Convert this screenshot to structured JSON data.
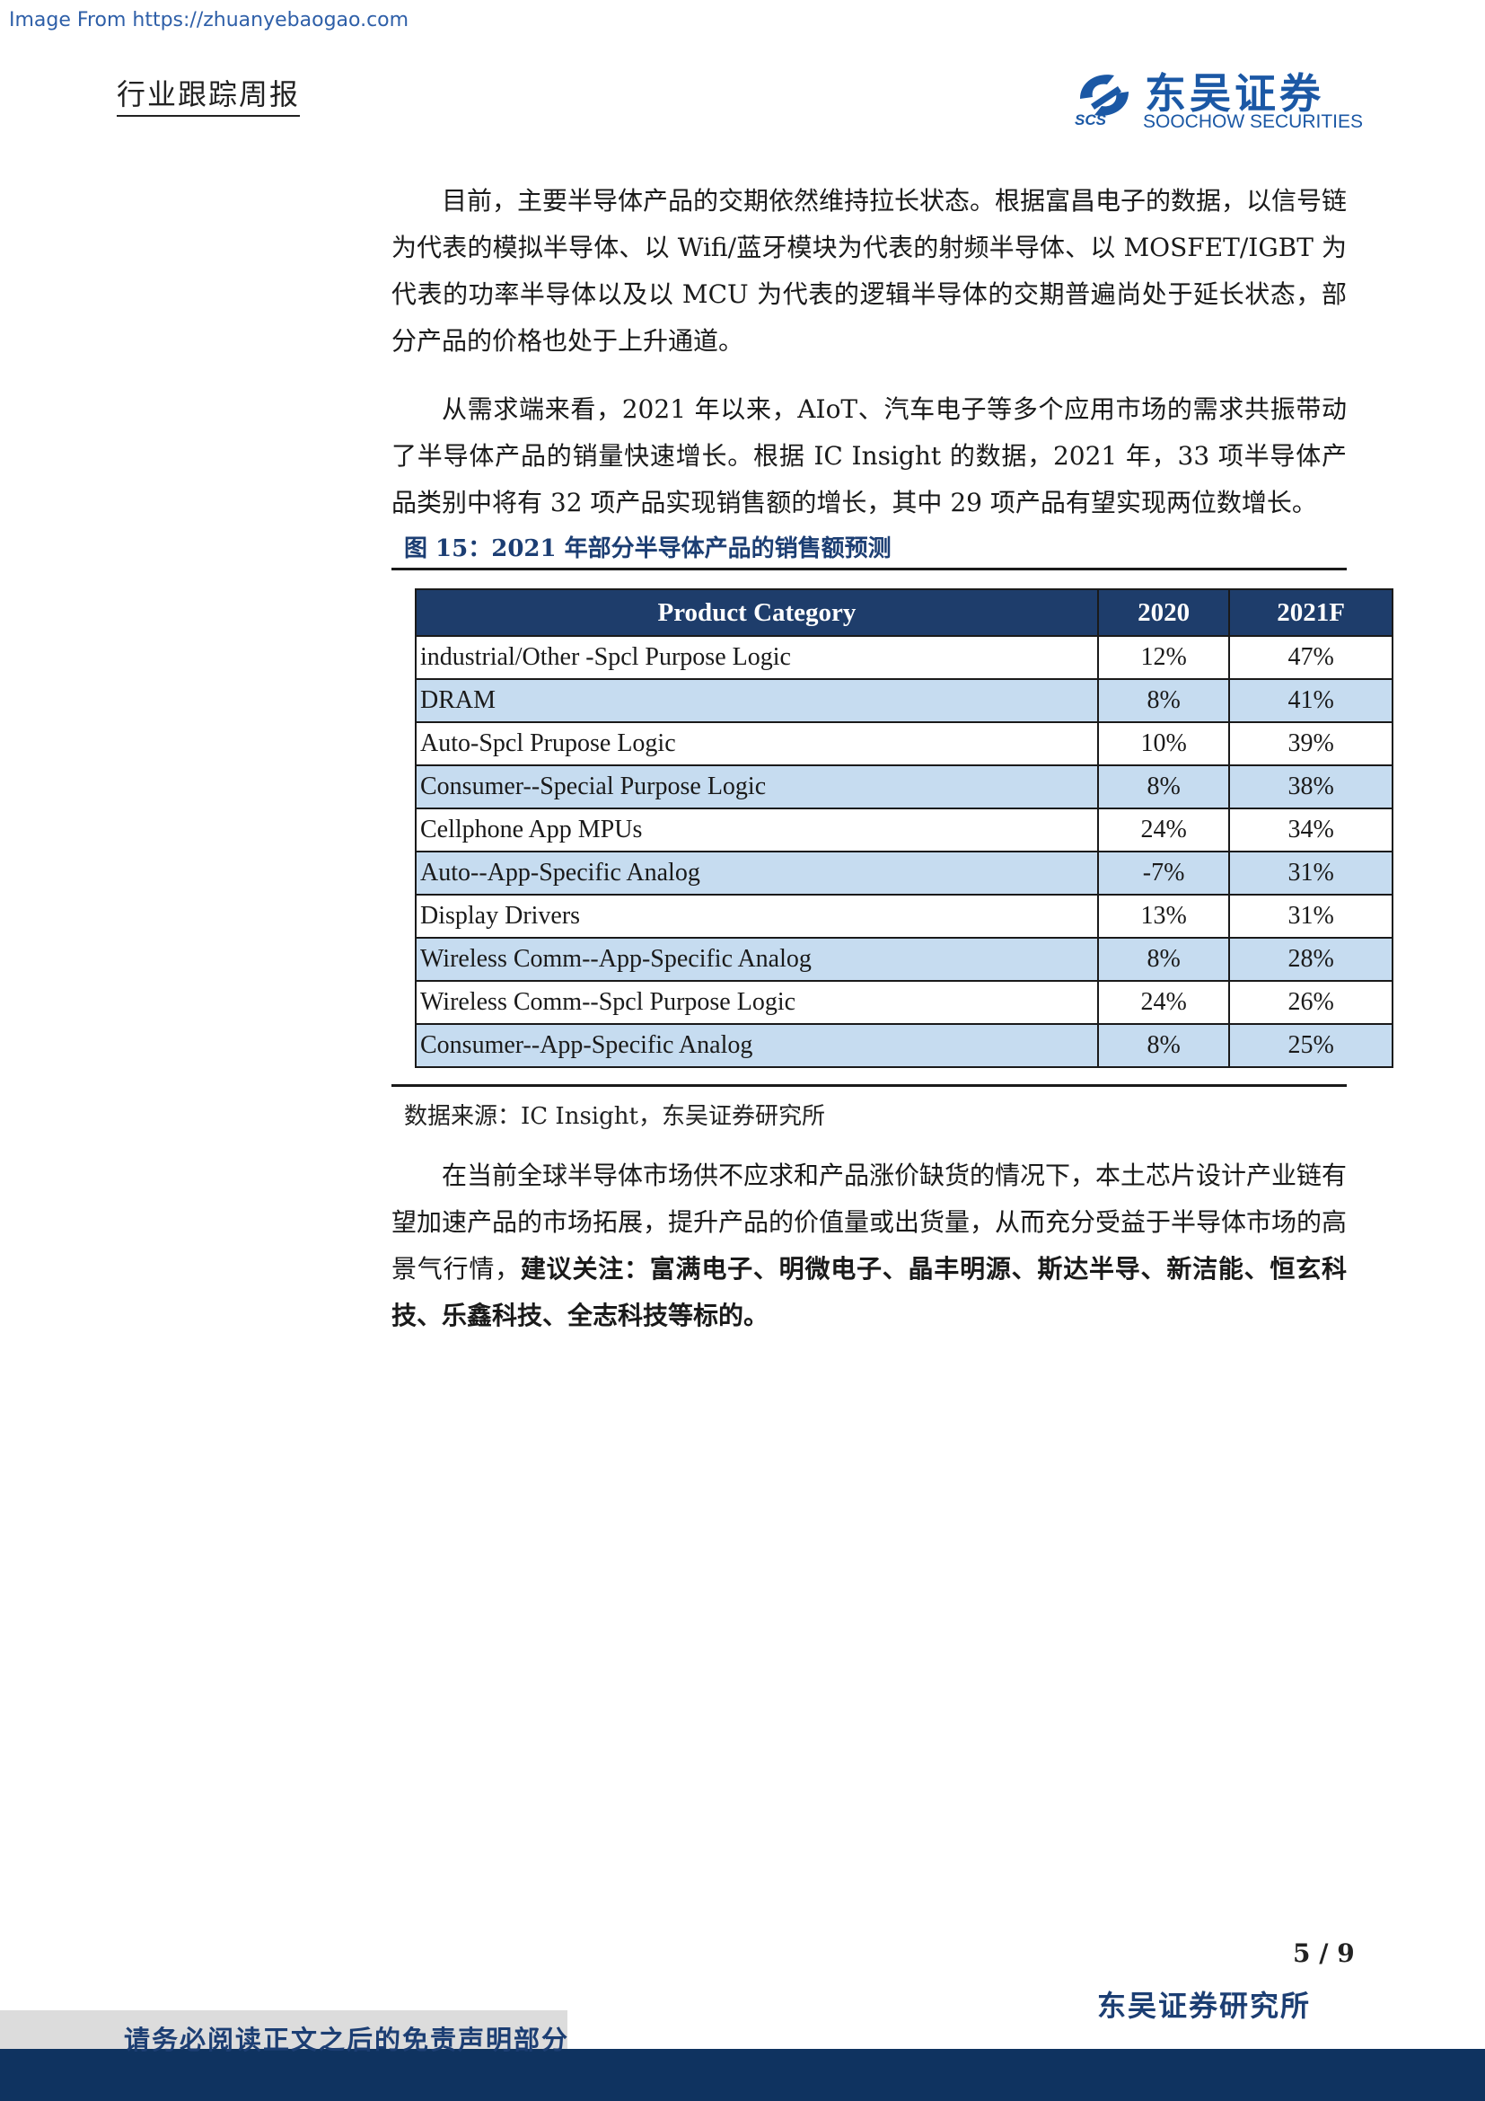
{
  "watermark": "Image From https://zhuanyebaogao.com",
  "header": {
    "report_type": "行业跟踪周报",
    "logo_cn": "东吴证券",
    "logo_en": "SOOCHOW SECURITIES",
    "logo_abbr": "SCS"
  },
  "paragraphs": [
    "目前，主要半导体产品的交期依然维持拉长状态。根据富昌电子的数据，以信号链为代表的模拟半导体、以 Wifi/蓝牙模块为代表的射频半导体、以 MOSFET/IGBT 为代表的功率半导体以及以 MCU 为代表的逻辑半导体的交期普遍尚处于延长状态，部分产品的价格也处于上升通道。",
    "从需求端来看，2021 年以来，AIoT、汽车电子等多个应用市场的需求共振带动了半导体产品的销量快速增长。根据 IC Insight 的数据，2021 年，33 项半导体产品类别中将有 32 项产品实现销售额的增长，其中 29 项产品有望实现两位数增长。"
  ],
  "figure": {
    "title": "图 15：2021 年部分半导体产品的销售额预测",
    "headers": [
      "Product Category",
      "2020",
      "2021F"
    ],
    "rows": [
      [
        "industrial/Other -Spcl Purpose Logic",
        "12%",
        "47%"
      ],
      [
        "DRAM",
        "8%",
        "41%"
      ],
      [
        "Auto-Spcl Prupose Logic",
        "10%",
        "39%"
      ],
      [
        "Consumer--Special Purpose Logic",
        "8%",
        "38%"
      ],
      [
        "Cellphone App MPUs",
        "24%",
        "34%"
      ],
      [
        "Auto--App-Specific Analog",
        "-7%",
        "31%"
      ],
      [
        "Display Drivers",
        "13%",
        "31%"
      ],
      [
        "Wireless Comm--App-Specific Analog",
        "8%",
        "28%"
      ],
      [
        "Wireless Comm--Spcl Purpose Logic",
        "24%",
        "26%"
      ],
      [
        "Consumer--App-Specific Analog",
        "8%",
        "25%"
      ]
    ],
    "source": "数据来源：IC Insight，东吴证券研究所"
  },
  "closing": {
    "text": "在当前全球半导体市场供不应求和产品涨价缺货的情况下，本土芯片设计产业链有望加速产品的市场拓展，提升产品的价值量或出货量，从而充分受益于半导体市场的高景气行情，",
    "bold": "建议关注：富满电子、明微电子、晶丰明源、斯达半导、新洁能、恒玄科技、乐鑫科技、全志科技等标的。"
  },
  "footer": {
    "page": "5 / 9",
    "institute": "东吴证券研究所",
    "disclaimer": "请务必阅读正文之后的免责声明部分"
  },
  "colors": {
    "brand_blue": "#1b58a5",
    "header_navy": "#1e3d6b",
    "alt_row": "#c6dcf0",
    "footer_band": "#0f3360"
  }
}
